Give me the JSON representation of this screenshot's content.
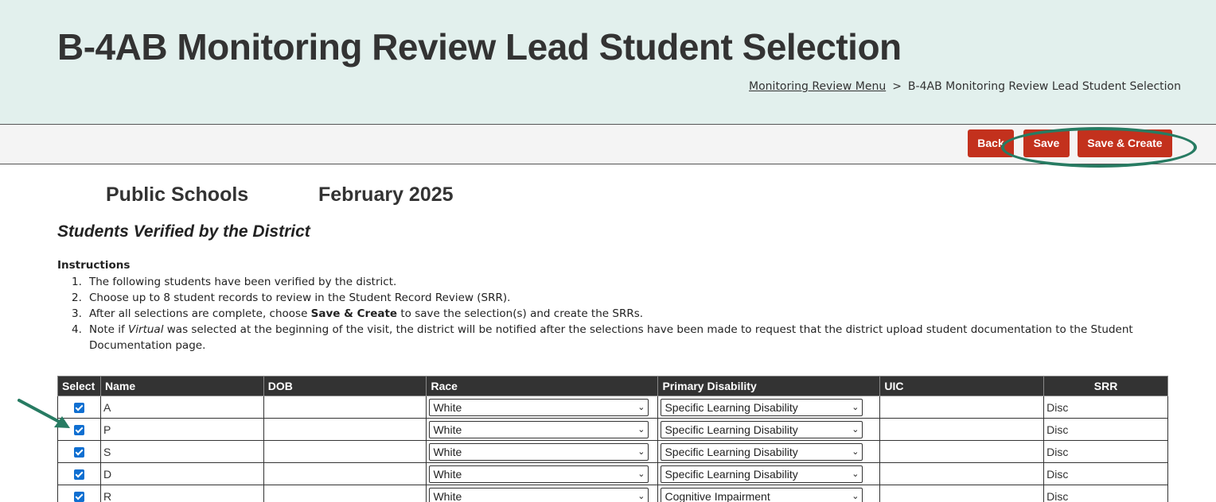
{
  "header": {
    "title": "B-4AB Monitoring Review Lead Student Selection",
    "breadcrumb": {
      "link": "Monitoring Review Menu",
      "separator": ">",
      "current": "B-4AB Monitoring Review Lead Student Selection"
    }
  },
  "toolbar": {
    "back_label": "Back",
    "save_label": "Save",
    "save_create_label": "Save & Create"
  },
  "district": {
    "name": "Public Schools",
    "period": "February 2025"
  },
  "section_title": "Students Verified by the District",
  "instructions": {
    "heading": "Instructions",
    "items": [
      {
        "num": "1.",
        "text": "The following students have been verified by the district."
      },
      {
        "num": "2.",
        "text": "Choose up to 8 student records to review in the Student Record Review (SRR)."
      },
      {
        "num": "3.",
        "pre": "After all selections are complete, choose ",
        "bold": "Save & Create",
        "post": " to save the selection(s) and create the SRRs."
      },
      {
        "num": "4.",
        "pre": "Note if ",
        "italic": "Virtual",
        "post": " was selected at the beginning of the visit, the district will be notified after the selections have been made to request that the district upload student documentation to the Student Documentation page."
      }
    ]
  },
  "table": {
    "columns": [
      "Select",
      "Name",
      "DOB",
      "Race",
      "Primary Disability",
      "UIC",
      "SRR"
    ],
    "rows": [
      {
        "selected": true,
        "name": "A",
        "dob": "",
        "race": "White",
        "disability": "Specific Learning Disability",
        "uic": "",
        "srr": "Disc"
      },
      {
        "selected": true,
        "name": "P",
        "dob": "",
        "race": "White",
        "disability": "Specific Learning Disability",
        "uic": "",
        "srr": "Disc"
      },
      {
        "selected": true,
        "name": "S",
        "dob": "",
        "race": "White",
        "disability": "Specific Learning Disability",
        "uic": "",
        "srr": "Disc"
      },
      {
        "selected": true,
        "name": "D",
        "dob": "",
        "race": "White",
        "disability": "Specific Learning Disability",
        "uic": "",
        "srr": "Disc"
      },
      {
        "selected": true,
        "name": "R",
        "dob": "",
        "race": "White",
        "disability": "Cognitive Impairment",
        "uic": "",
        "srr": "Disc"
      }
    ]
  },
  "colors": {
    "header_bg": "#e2f0ed",
    "button_red": "#c3311d",
    "annotation_green": "#277b62",
    "table_header_bg": "#333333"
  }
}
